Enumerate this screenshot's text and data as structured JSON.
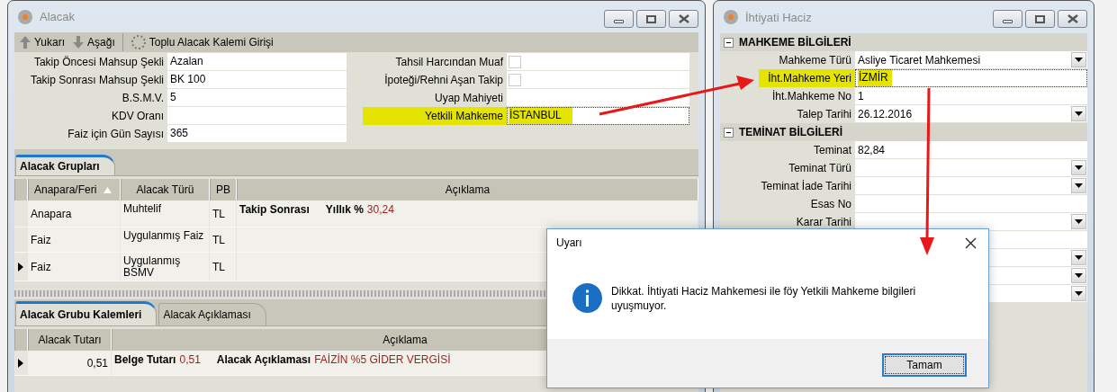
{
  "left_window": {
    "title": "Alacak",
    "toolbar": [
      {
        "label": "Yukarı",
        "kind": "up"
      },
      {
        "label": "Aşağı",
        "kind": "down"
      },
      {
        "label": "Toplu Alacak Kalemi Girişi",
        "kind": "spinner"
      }
    ],
    "form_left": [
      {
        "label": "Takip Öncesi Mahsup Şekli",
        "value": "Azalan"
      },
      {
        "label": "Takip Sonrası Mahsup Şekli",
        "value": "BK 100"
      },
      {
        "label": "B.S.M.V.",
        "value": "5"
      },
      {
        "label": "KDV Oranı"
      },
      {
        "label": "Faiz için Gün Sayısı",
        "value": "365"
      }
    ],
    "form_right": [
      {
        "label": "Tahsil Harcından Muaf",
        "kind": "checkbox",
        "checked": false
      },
      {
        "label": "İpoteği/Rehni Aşan Takip",
        "kind": "checkbox",
        "checked": false
      },
      {
        "label": "Uyap Mahiyeti",
        "kind": "text"
      },
      {
        "label": "Yetkili Mahkeme",
        "kind": "text",
        "value": "İSTANBUL",
        "highlighted": true,
        "focused": true
      }
    ],
    "groups_tabs": [
      {
        "label": "Alacak Grupları",
        "selected": true
      }
    ],
    "groups_table": {
      "columns": [
        "Anapara/Feri",
        "Alacak Türü",
        "PB",
        "Açıklama"
      ],
      "rows": [
        {
          "current": false,
          "cells": [
            "Anapara",
            "Muhtelif",
            "TL"
          ],
          "description": [
            {
              "label": "Takip Sonrası"
            },
            {
              "label": "Yıllık %",
              "value": "30,24"
            }
          ]
        },
        {
          "current": false,
          "cells": [
            "Faiz",
            "Uygulanmış Faiz",
            "TL"
          ]
        },
        {
          "current": true,
          "cells": [
            "Faiz",
            "Uygulanmış BSMV",
            "TL"
          ]
        }
      ]
    },
    "items_tabs": [
      {
        "label": "Alacak Grubu Kalemleri",
        "selected": true
      },
      {
        "label": "Alacak Açıklaması",
        "selected": false
      }
    ],
    "items_table": {
      "columns": [
        "Alacak Tutarı",
        "Açıklama"
      ],
      "rows": [
        {
          "current": true,
          "amount": "0,51",
          "description": [
            {
              "label": "Belge Tutarı",
              "value": "0,51"
            },
            {
              "label": "Alacak Açıklaması",
              "value": "FAİZİN %5 GİDER VERGİSİ"
            }
          ]
        }
      ]
    }
  },
  "right_window": {
    "title": "İhtiyati Haciz",
    "sections": [
      {
        "title": "MAHKEME BİLGİLERİ",
        "expanded": true,
        "fields": [
          {
            "label": "Mahkeme Türü",
            "value": "Asliye Ticaret Mahkemesi",
            "kind": "dropdown"
          },
          {
            "label": "İht.Mahkeme Yeri",
            "value": "İZMİR",
            "kind": "text",
            "highlighted": true,
            "focused": true
          },
          {
            "label": "İht.Mahkeme No",
            "value": "1",
            "kind": "text"
          },
          {
            "label": "Talep Tarihi",
            "value": "26.12.2016",
            "kind": "dropdown"
          }
        ]
      },
      {
        "title": "TEMİNAT BİLGİLERİ",
        "expanded": true,
        "fields": [
          {
            "label": "Teminat",
            "value": "82,84",
            "kind": "text"
          },
          {
            "label": "Teminat Türü",
            "kind": "dropdown"
          },
          {
            "label": "Teminat İade Tarihi",
            "kind": "dropdown"
          },
          {
            "label": "Esas No",
            "kind": "text"
          },
          {
            "label": "Karar Tarihi",
            "kind": "dropdown"
          },
          {
            "kind": "text"
          },
          {
            "kind": "dropdown"
          },
          {
            "kind": "dropdown"
          },
          {
            "kind": "dropdown"
          }
        ]
      }
    ]
  },
  "dialog": {
    "title": "Uyarı",
    "message": "Dikkat. İhtiyati Haciz Mahkemesi ile föy Yetkili Mahkeme bilgileri uyuşmuyor.",
    "button": "Tamam"
  }
}
